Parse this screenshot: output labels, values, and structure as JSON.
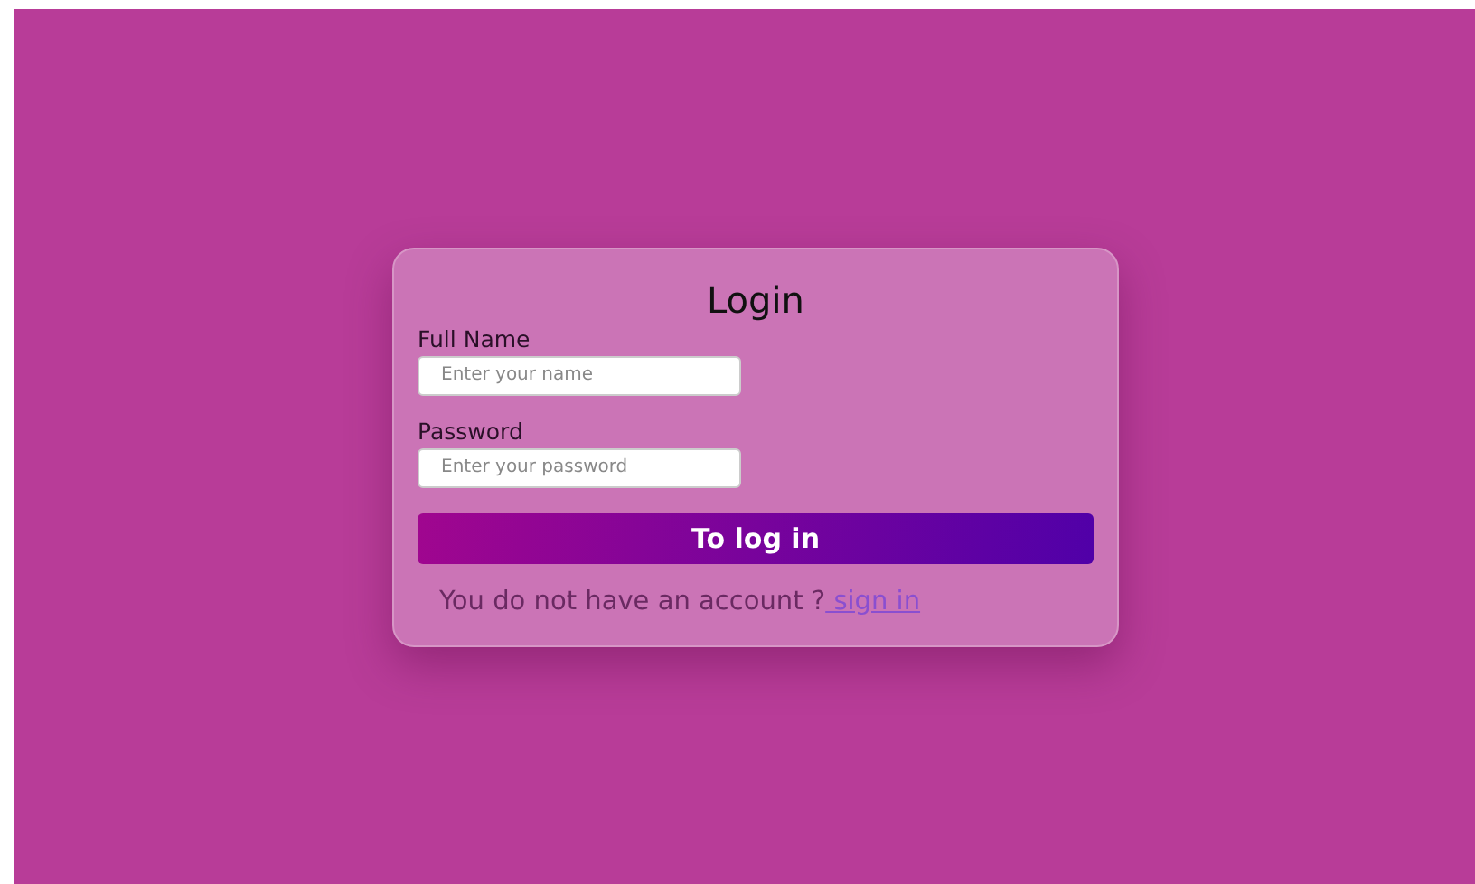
{
  "form": {
    "title": "Login",
    "fields": [
      {
        "label": "Full Name",
        "placeholder": "Enter your name"
      },
      {
        "label": "Password",
        "placeholder": "Enter your password"
      }
    ],
    "submit": "To log in",
    "footer": {
      "prompt": "You do not have an account ?",
      "link": " sign in"
    }
  }
}
